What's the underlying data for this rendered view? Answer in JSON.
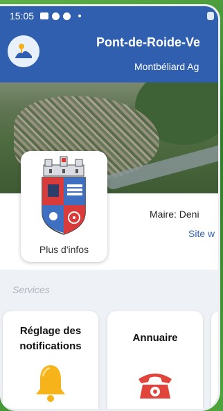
{
  "status_bar": {
    "time": "15:05"
  },
  "header": {
    "city": "Pont-de-Roide-Ve",
    "agglo": "Montbéliard Ag"
  },
  "mayor": {
    "text": "Maire: Deni",
    "link": "Site w"
  },
  "crest": {
    "more_label": "Plus d'infos"
  },
  "services": {
    "title": "Services",
    "items": [
      {
        "label_line1": "Réglage des",
        "label_line2": "notifications",
        "icon": "bell-icon",
        "color": "#f6b31a"
      },
      {
        "label": "Annuaire",
        "icon": "telephone-icon",
        "color": "#e0443a"
      }
    ]
  },
  "colors": {
    "header": "#2f5fae",
    "link": "#2f5fae",
    "frame": "#3a8a2c"
  }
}
